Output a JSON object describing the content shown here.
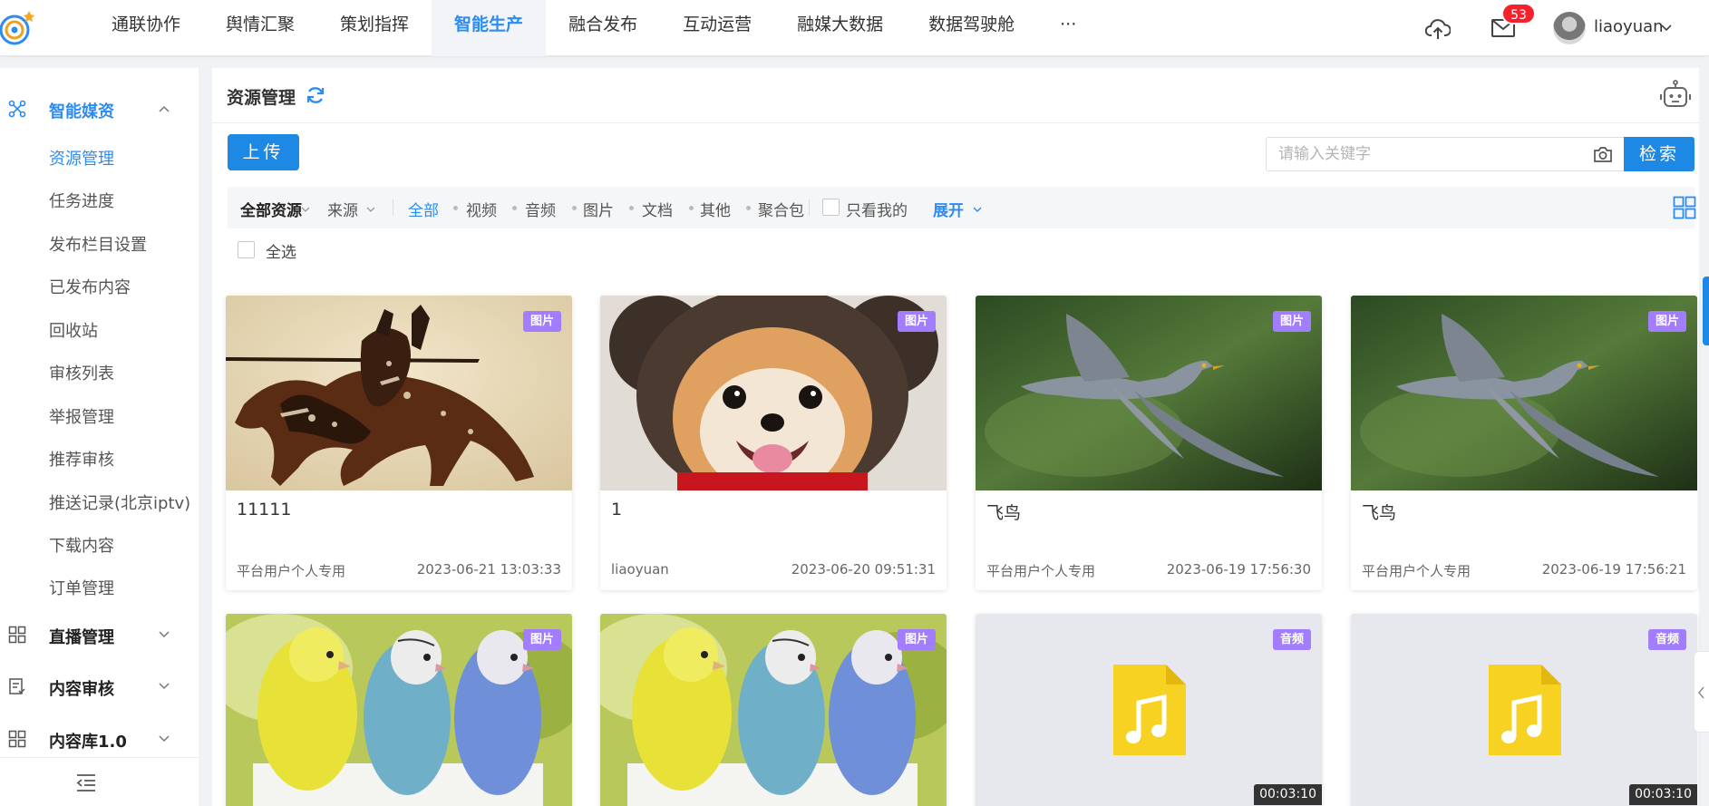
{
  "nav": {
    "items": [
      "通联协作",
      "舆情汇聚",
      "策划指挥",
      "智能生产",
      "融合发布",
      "互动运营",
      "融媒大数据",
      "数据驾驶舱",
      "···"
    ],
    "active_index": 3
  },
  "header": {
    "mail_count": "53",
    "username": "liaoyuan"
  },
  "sidebar": {
    "group_media": "智能媒资",
    "sub_items": [
      "资源管理",
      "任务进度",
      "发布栏目设置",
      "已发布内容",
      "回收站",
      "审核列表",
      "举报管理",
      "推荐审核",
      "推送记录(北京iptv)",
      "下载内容",
      "订单管理"
    ],
    "group_live": "直播管理",
    "group_review": "内容审核",
    "group_library": "内容库1.0"
  },
  "main": {
    "title": "资源管理",
    "upload_label": "上传",
    "search_placeholder": "请输入关键字",
    "search_label": "检索",
    "filters": {
      "all_resources": "全部资源",
      "source": "来源",
      "types": [
        "全部",
        "视频",
        "音频",
        "图片",
        "文档",
        "其他",
        "聚合包"
      ],
      "only_mine": "只看我的",
      "expand": "展开"
    },
    "select_all": "全选"
  },
  "cards": [
    {
      "tag": "图片",
      "title": "11111",
      "author": "平台用户个人专用",
      "time": "2023-06-21 13:03:33",
      "image": "shadow-puppet-horse-rider"
    },
    {
      "tag": "图片",
      "title": "1",
      "author": "liaoyuan",
      "time": "2023-06-20 09:51:31",
      "image": "pomeranian-dog-hat"
    },
    {
      "tag": "图片",
      "title": "飞鸟",
      "author": "平台用户个人专用",
      "time": "2023-06-19 17:56:30",
      "image": "flying-cuckoo-bird"
    },
    {
      "tag": "图片",
      "title": "飞鸟",
      "author": "平台用户个人专用",
      "time": "2023-06-19 17:56:21",
      "image": "flying-cuckoo-bird"
    },
    {
      "tag": "图片",
      "image": "three-budgerigars"
    },
    {
      "tag": "图片",
      "image": "three-budgerigars"
    },
    {
      "tag": "音频",
      "duration": "00:03:10",
      "image": "music-file-icon"
    },
    {
      "tag": "音频",
      "duration": "00:03:10",
      "image": "music-file-icon"
    }
  ],
  "colors": {
    "primary": "#1e88e5",
    "active_text": "#2d8cf0",
    "tag_bg": "#a27dff",
    "badge": "#f5222d"
  }
}
